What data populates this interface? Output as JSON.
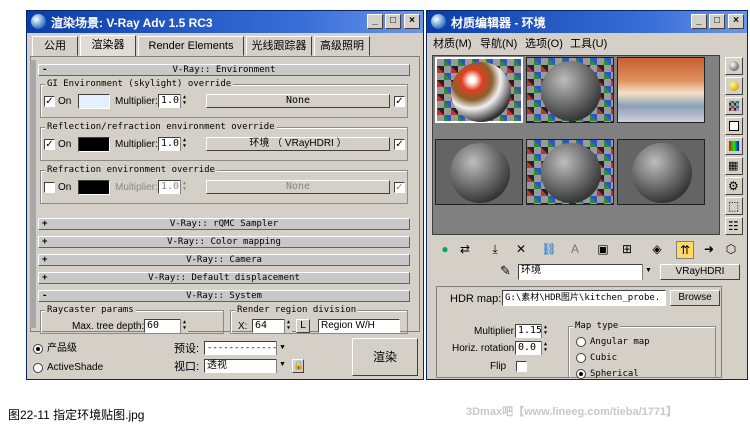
{
  "render_window": {
    "title": "渲染场景: V-Ray Adv 1.5 RC3",
    "tabs": [
      "公用",
      "渲染器",
      "Render Elements",
      "光线跟踪器",
      "高级照明"
    ],
    "environment": {
      "header": "V-Ray:: Environment",
      "gi": {
        "title": "GI Environment (skylight) override",
        "on_label": "On",
        "on": true,
        "multiplier_label": "Multiplier:",
        "multiplier": "1.0",
        "map": "None",
        "color": "#e4f0ff"
      },
      "reflection": {
        "title": "Reflection/refraction environment override",
        "on_label": "On",
        "on": true,
        "multiplier_label": "Multiplier:",
        "multiplier": "1.0",
        "map": "环境 （ VRayHDRI ）",
        "color": "#000000"
      },
      "refraction": {
        "title": "Refraction environment override",
        "on_label": "On",
        "on": false,
        "multiplier_label": "Multiplier:",
        "multiplier": "1.0",
        "map": "None",
        "color": "#000000"
      }
    },
    "rollouts": [
      "V-Ray:: rQMC Sampler",
      "V-Ray:: Color mapping",
      "V-Ray:: Camera",
      "V-Ray:: Default displacement",
      "V-Ray:: System"
    ],
    "system": {
      "raycaster_title": "Raycaster params",
      "max_depth_label": "Max. tree depth:",
      "max_depth": "60",
      "region_title": "Render region division",
      "x_label": "X:",
      "x_value": "64",
      "l_label": "L",
      "region_mode": "Region W/H"
    },
    "bottom": {
      "radio_product": "产品级",
      "radio_activeshade": "ActiveShade",
      "preset_label": "预设:",
      "preset_value": "-------------------",
      "viewport_label": "视口:",
      "viewport_value": "透视",
      "render_button": "渲染"
    }
  },
  "material_editor": {
    "title": "材质编辑器 - 环境",
    "menu": [
      "材质(M)",
      "导航(N)",
      "选项(O)",
      "工具(U)"
    ],
    "map_name": "环境",
    "map_type": "VRayHDRI",
    "params": {
      "hdr_map_label": "HDR map:",
      "hdr_map_path": "G:\\素材\\HDR图片\\kitchen_probe.",
      "browse_label": "Browse",
      "multiplier_label": "Multiplier:",
      "multiplier": "1.15",
      "horiz_label": "Horiz. rotation:",
      "horiz": "0.0",
      "flip_label": "Flip",
      "map_type_title": "Map type",
      "map_types": [
        "Angular map",
        "Cubic",
        "Spherical"
      ]
    }
  },
  "caption": "图22-11 指定环境贴图.jpg",
  "watermark": "3Dmax吧【www.lineeg.com/tieba/1771】",
  "colors": {
    "titlebar": "#0a3da8",
    "face": "#d4d0c8"
  }
}
